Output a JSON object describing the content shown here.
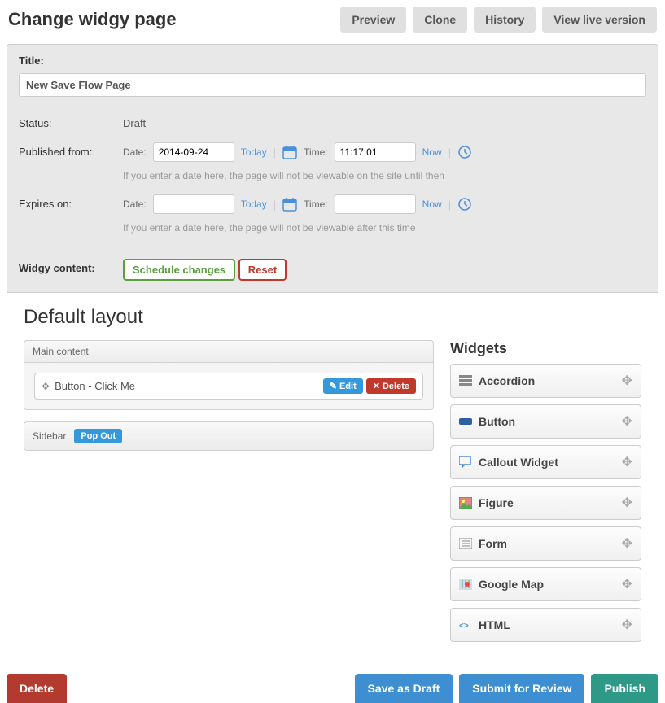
{
  "header": {
    "title": "Change widgy page",
    "buttons": {
      "preview": "Preview",
      "clone": "Clone",
      "history": "History",
      "view_live": "View live version"
    }
  },
  "form": {
    "title_label": "Title:",
    "title_value": "New Save Flow Page",
    "status_label": "Status:",
    "status_value": "Draft",
    "published_from_label": "Published from:",
    "expires_on_label": "Expires on:",
    "date_label": "Date:",
    "time_label": "Time:",
    "today_link": "Today",
    "now_link": "Now",
    "published_date": "2014-09-24",
    "published_time": "11:17:01",
    "expires_date": "",
    "expires_time": "",
    "published_help": "If you enter a date here, the page will not be viewable on the site until then",
    "expires_help": "If you enter a date here, the page will not be viewable after this time",
    "widgy_content_label": "Widgy content:",
    "schedule_btn": "Schedule changes",
    "reset_btn": "Reset"
  },
  "layout": {
    "title": "Default layout",
    "main_region_label": "Main content",
    "sidebar_region_label": "Sidebar",
    "pop_out": "Pop Out",
    "item_label": "Button - Click Me",
    "edit_btn": "Edit",
    "delete_btn": "Delete"
  },
  "widgets": {
    "title": "Widgets",
    "items": [
      {
        "name": "Accordion",
        "icon": "accordion"
      },
      {
        "name": "Button",
        "icon": "button"
      },
      {
        "name": "Callout Widget",
        "icon": "callout"
      },
      {
        "name": "Figure",
        "icon": "figure"
      },
      {
        "name": "Form",
        "icon": "form"
      },
      {
        "name": "Google Map",
        "icon": "map"
      },
      {
        "name": "HTML",
        "icon": "html"
      }
    ]
  },
  "footer": {
    "delete": "Delete",
    "save_draft": "Save as Draft",
    "submit_review": "Submit for Review",
    "publish": "Publish"
  }
}
